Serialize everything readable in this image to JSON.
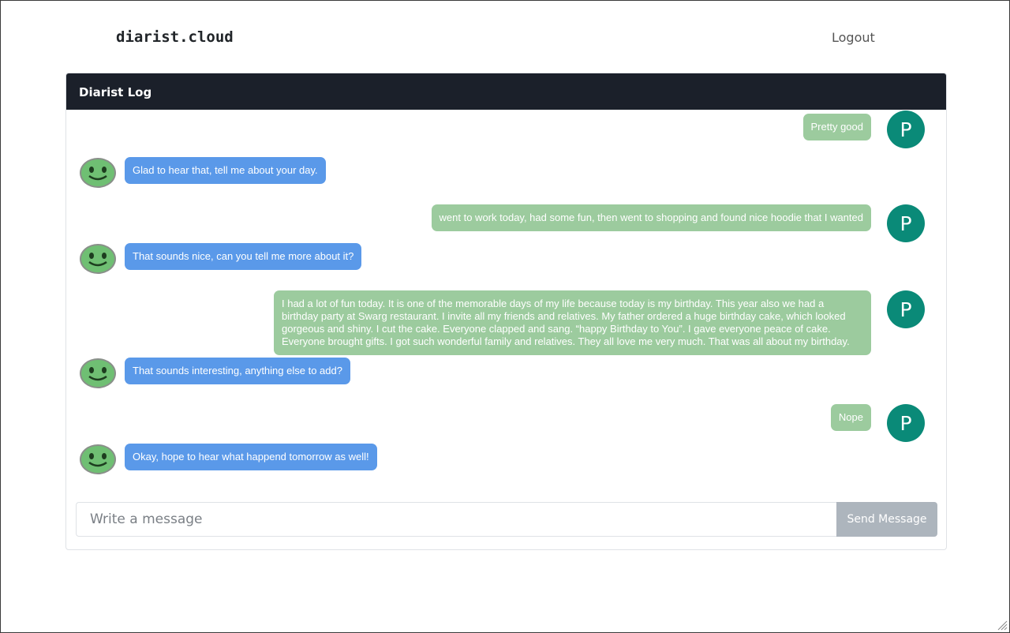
{
  "navbar": {
    "brand": "diarist.cloud",
    "logout_label": "Logout"
  },
  "card": {
    "title": "Diarist Log"
  },
  "user": {
    "initial": "P",
    "avatar_color": "#0a8a78"
  },
  "colors": {
    "bot_bubble": "#5a99e9",
    "user_bubble": "#9ccb9e",
    "header_bg": "#1b202a"
  },
  "messages": [
    {
      "sender": "user",
      "text": "Pretty good"
    },
    {
      "sender": "bot",
      "text": "Glad to hear that, tell me about your day."
    },
    {
      "sender": "user",
      "text": "went to work today, had some fun, then went to shopping and found nice hoodie that I wanted"
    },
    {
      "sender": "bot",
      "text": "That sounds nice, can you tell me more about it?"
    },
    {
      "sender": "user",
      "text": "I had a lot of fun today. It is one of the memorable days of my life because today is my birthday. This year also we had a birthday party at Swarg restaurant. I invite all my friends and relatives. My father ordered a huge birthday cake, which looked gorgeous and shiny. I cut the cake. Everyone clapped and sang. “happy Birthday to You”. I gave everyone peace of cake. Everyone brought gifts. I got such wonderful family and relatives. They all love me very much. That was all about my birthday."
    },
    {
      "sender": "bot",
      "text": "That sounds interesting, anything else to add?"
    },
    {
      "sender": "user",
      "text": "Nope"
    },
    {
      "sender": "bot",
      "text": "Okay, hope to hear what happend tomorrow as well!"
    }
  ],
  "composer": {
    "placeholder": "Write a message",
    "value": "",
    "send_label": "Send Message"
  }
}
